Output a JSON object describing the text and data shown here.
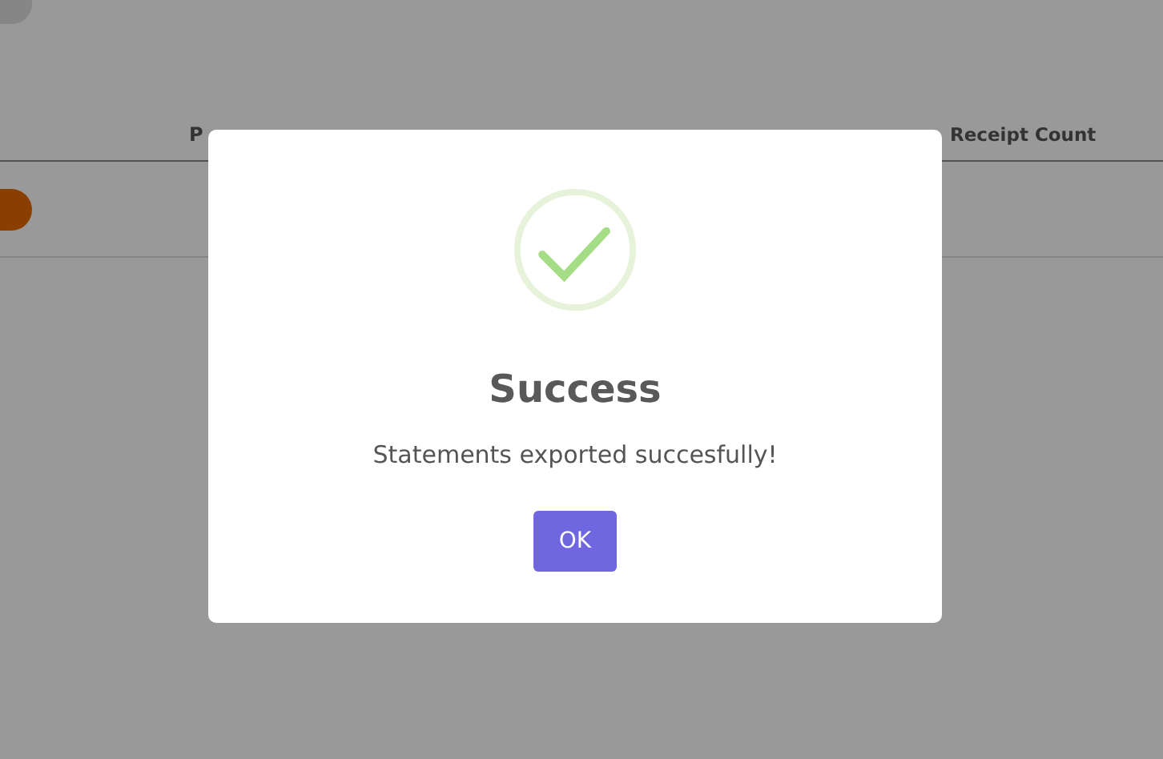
{
  "background": {
    "table": {
      "columns": [
        {
          "label": "P"
        },
        {
          "label": "Receipt Count"
        }
      ]
    }
  },
  "dialog": {
    "title": "Success",
    "message": "Statements exported succesfully!",
    "button": "OK"
  }
}
